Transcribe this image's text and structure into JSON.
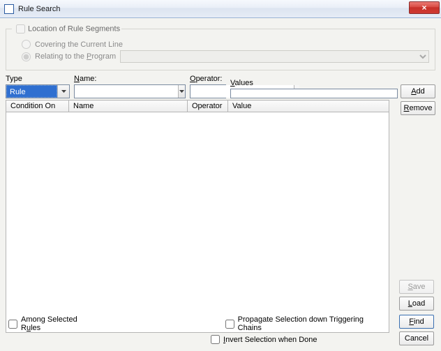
{
  "window": {
    "title": "Rule Search",
    "close_label": "×"
  },
  "location_group": {
    "legend": "Location of Rule Segments",
    "radio_covering": "Covering the Current Line",
    "radio_program_prefix": "Relating to the ",
    "radio_program_underline": "P",
    "radio_program_suffix": "rogram",
    "program_value": ""
  },
  "filter": {
    "type_label": "Type",
    "name_label_underline": "N",
    "name_label_rest": "ame:",
    "operator_label_underline": "O",
    "operator_label_rest": "perator:",
    "values_label_underline": "V",
    "values_label_rest": "alues",
    "type_value": "Rule",
    "name_value": "",
    "operator_value": "",
    "values_value": ""
  },
  "buttons": {
    "add_u": "A",
    "add_r": "dd",
    "remove_u": "R",
    "remove_r": "emove",
    "save_u": "S",
    "save_r": "ave",
    "load_u": "L",
    "load_r": "oad",
    "find_u": "F",
    "find_r": "ind",
    "cancel": "Cancel"
  },
  "table": {
    "headers": {
      "condition_on": "Condition On",
      "name": "Name",
      "operator": "Operator",
      "value": "Value"
    },
    "rows": []
  },
  "checks": {
    "among_pre": "Among Selected R",
    "among_u": "u",
    "among_post": "les",
    "propagate": "Propagate Selection down Triggering Chains",
    "invert_pre": "",
    "invert_u": "I",
    "invert_post": "nvert Selection when Done"
  }
}
